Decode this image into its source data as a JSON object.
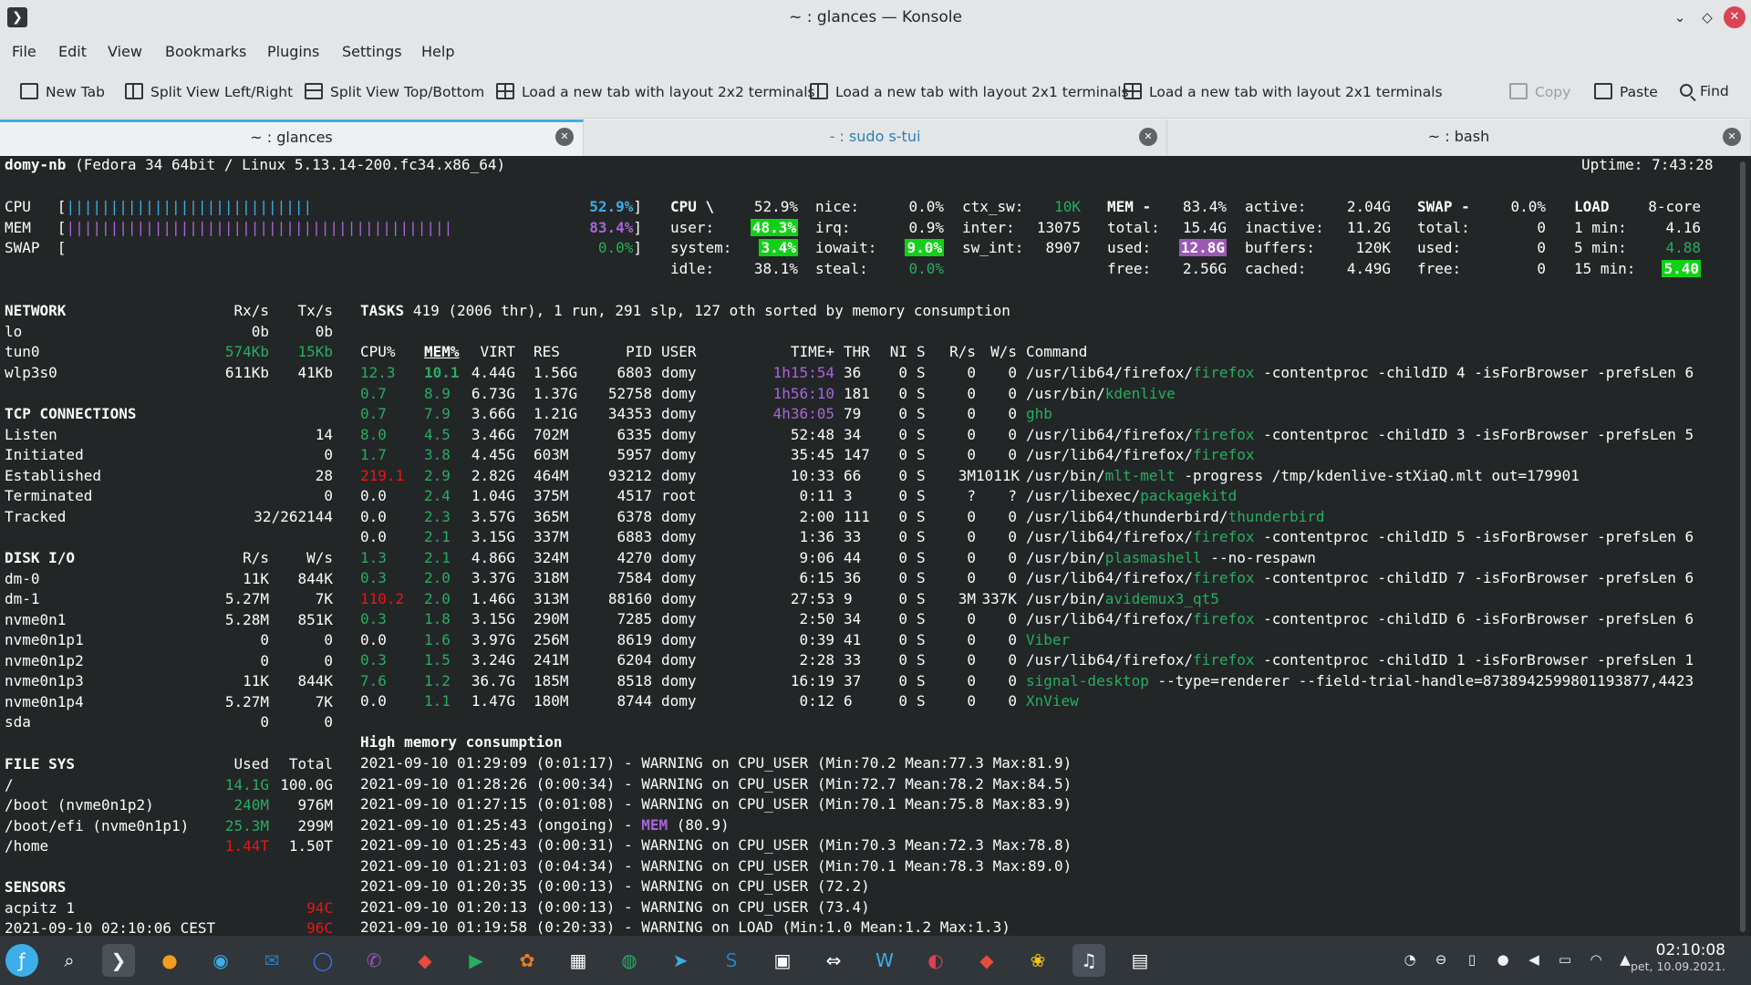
{
  "window": {
    "title": "~ : glances — Konsole",
    "minimize": "⌄",
    "maximize": "◇",
    "close": "✕"
  },
  "menu": [
    "File",
    "Edit",
    "View",
    "Bookmarks",
    "Plugins",
    "Settings",
    "Help"
  ],
  "toolbar": {
    "new_tab": "New Tab",
    "split_lr": "Split View Left/Right",
    "split_tb": "Split View Top/Bottom",
    "load_2x2": "Load a new tab with layout 2x2 terminals",
    "load_2x1_a": "Load a new tab with layout 2x1 terminals",
    "load_2x1_b": "Load a new tab with layout 2x1 terminals",
    "copy": "Copy",
    "paste": "Paste",
    "find": "Find"
  },
  "tabs": [
    {
      "label": "~ : glances"
    },
    {
      "label": "- : sudo s-tui"
    },
    {
      "label": "~ : bash"
    }
  ],
  "glances": {
    "host": "domy-nb",
    "os": "(Fedora 34 64bit / Linux 5.13.14-200.fc34.x86_64)",
    "uptime": "Uptime: 7:43:28",
    "quicklook": {
      "cpu_label": "CPU",
      "cpu_bar": "||||||||||||||||||||||||||||",
      "cpu_pct": "52.9%",
      "mem_label": "MEM",
      "mem_bar": "||||||||||||||||||||||||||||||||||||||||||||",
      "mem_pct": "83.4%",
      "swap_label": "SWAP",
      "swap_pct": "0.0%"
    },
    "cpu": {
      "title": "CPU \\",
      "total": "52.9%",
      "user_label": "user:",
      "user": "48.3%",
      "system_label": "system:",
      "system": "3.4%",
      "idle_label": "idle:",
      "idle": "38.1%",
      "nice_label": "nice:",
      "nice": "0.0%",
      "irq_label": "irq:",
      "irq": "0.9%",
      "iowait_label": "iowait:",
      "iowait": "9.0%",
      "steal_label": "steal:",
      "steal": "0.0%",
      "ctx_sw_label": "ctx_sw:",
      "ctx_sw": "10K",
      "inter_label": "inter:",
      "inter": "13075",
      "sw_int_label": "sw_int:",
      "sw_int": "8907"
    },
    "mem": {
      "title": "MEM -",
      "pct": "83.4%",
      "total_label": "total:",
      "total": "15.4G",
      "used_label": "used:",
      "used": "12.8G",
      "free_label": "free:",
      "free": "2.56G",
      "active_label": "active:",
      "active": "2.04G",
      "inactive_label": "inactive:",
      "inactive": "11.2G",
      "buffers_label": "buffers:",
      "buffers": "120K",
      "cached_label": "cached:",
      "cached": "4.49G"
    },
    "swap": {
      "title": "SWAP -",
      "pct": "0.0%",
      "total_label": "total:",
      "total": "0",
      "used_label": "used:",
      "used": "0",
      "free_label": "free:",
      "free": "0"
    },
    "load": {
      "title": "LOAD",
      "cores": "8-core",
      "min1_label": "1 min:",
      "min1": "4.16",
      "min5_label": "5 min:",
      "min5": "4.88",
      "min15_label": "15 min:",
      "min15": "5.40"
    },
    "network": {
      "title": "NETWORK",
      "rx_header": "Rx/s",
      "tx_header": "Tx/s",
      "rows": [
        {
          "iface": "lo",
          "rx": "0b",
          "tx": "0b"
        },
        {
          "iface": "tun0",
          "rx": "574Kb",
          "tx": "15Kb"
        },
        {
          "iface": "wlp3s0",
          "rx": "611Kb",
          "tx": "41Kb"
        }
      ]
    },
    "tcp": {
      "title": "TCP CONNECTIONS",
      "rows": [
        {
          "label": "Listen",
          "value": "14"
        },
        {
          "label": "Initiated",
          "value": "0"
        },
        {
          "label": "Established",
          "value": "28"
        },
        {
          "label": "Terminated",
          "value": "0"
        },
        {
          "label": "Tracked",
          "value": "32/262144"
        }
      ]
    },
    "diskio": {
      "title": "DISK I/O",
      "r_header": "R/s",
      "w_header": "W/s",
      "rows": [
        {
          "dev": "dm-0",
          "r": "11K",
          "w": "844K"
        },
        {
          "dev": "dm-1",
          "r": "5.27M",
          "w": "7K"
        },
        {
          "dev": "nvme0n1",
          "r": "5.28M",
          "w": "851K"
        },
        {
          "dev": "nvme0n1p1",
          "r": "0",
          "w": "0"
        },
        {
          "dev": "nvme0n1p2",
          "r": "0",
          "w": "0"
        },
        {
          "dev": "nvme0n1p3",
          "r": "11K",
          "w": "844K"
        },
        {
          "dev": "nvme0n1p4",
          "r": "5.27M",
          "w": "7K"
        },
        {
          "dev": "sda",
          "r": "0",
          "w": "0"
        }
      ]
    },
    "filesys": {
      "title": "FILE SYS",
      "used_header": "Used",
      "total_header": "Total",
      "rows": [
        {
          "mnt": "/",
          "used": "14.1G",
          "total": "100.0G"
        },
        {
          "mnt": "/boot (nvme0n1p2)",
          "used": "240M",
          "total": "976M"
        },
        {
          "mnt": "/boot/efi (nvme0n1p1)",
          "used": "25.3M",
          "total": "299M"
        },
        {
          "mnt": "/home",
          "used": "1.44T",
          "total": "1.50T"
        }
      ]
    },
    "sensors": {
      "title": "SENSORS",
      "rows": [
        {
          "label": "acpitz 1",
          "value": "94C"
        },
        {
          "label": "2021-09-10 02:10:06 CEST",
          "value": "96C"
        }
      ]
    },
    "tasks": {
      "summary_title": "TASKS",
      "summary": "419 (2006 thr), 1 run, 291 slp, 127 oth sorted by memory consumption",
      "headers": {
        "cpu": "CPU%",
        "mem": "MEM%",
        "virt": "VIRT",
        "res": "RES",
        "pid": "PID",
        "user": "USER",
        "time": "TIME+",
        "thr": "THR",
        "ni": "NI",
        "s": "S",
        "rs": "R/s",
        "ws": "W/s",
        "cmd": "Command"
      },
      "rows": [
        {
          "cpu": "12.3",
          "mem": "10.1",
          "virt": "4.44G",
          "res": "1.56G",
          "pid": "6803",
          "user": "domy",
          "time": "1h15:54",
          "thr": "36",
          "ni": "0",
          "s": "S",
          "rs": "0",
          "ws": "0",
          "cmd_pre": "/usr/lib64/firefox/",
          "cmd_hl": "firefox",
          "cmd_post": " -contentproc -childID 4 -isForBrowser -prefsLen 6"
        },
        {
          "cpu": "0.7",
          "mem": "8.9",
          "virt": "6.73G",
          "res": "1.37G",
          "pid": "52758",
          "user": "domy",
          "time": "1h56:10",
          "thr": "181",
          "ni": "0",
          "s": "S",
          "rs": "0",
          "ws": "0",
          "cmd_pre": "/usr/bin/",
          "cmd_hl": "kdenlive",
          "cmd_post": ""
        },
        {
          "cpu": "0.7",
          "mem": "7.9",
          "virt": "3.66G",
          "res": "1.21G",
          "pid": "34353",
          "user": "domy",
          "time": "4h36:05",
          "thr": "79",
          "ni": "0",
          "s": "S",
          "rs": "0",
          "ws": "0",
          "cmd_pre": "",
          "cmd_hl": "ghb",
          "cmd_post": ""
        },
        {
          "cpu": "8.0",
          "mem": "4.5",
          "virt": "3.46G",
          "res": "702M",
          "pid": "6335",
          "user": "domy",
          "time": "52:48",
          "thr": "34",
          "ni": "0",
          "s": "S",
          "rs": "0",
          "ws": "0",
          "cmd_pre": "/usr/lib64/firefox/",
          "cmd_hl": "firefox",
          "cmd_post": " -contentproc -childID 3 -isForBrowser -prefsLen 5"
        },
        {
          "cpu": "1.7",
          "mem": "3.8",
          "virt": "4.45G",
          "res": "603M",
          "pid": "5957",
          "user": "domy",
          "time": "35:45",
          "thr": "147",
          "ni": "0",
          "s": "S",
          "rs": "0",
          "ws": "0",
          "cmd_pre": "/usr/lib64/firefox/",
          "cmd_hl": "firefox",
          "cmd_post": ""
        },
        {
          "cpu": "219.1",
          "mem": "2.9",
          "virt": "2.82G",
          "res": "464M",
          "pid": "93212",
          "user": "domy",
          "time": "10:33",
          "thr": "66",
          "ni": "0",
          "s": "S",
          "rs": "3M",
          "ws": "1011K",
          "cmd_pre": "/usr/bin/",
          "cmd_hl": "mlt-melt",
          "cmd_post": " -progress /tmp/kdenlive-stXiaQ.mlt out=179901"
        },
        {
          "cpu": "0.0",
          "mem": "2.4",
          "virt": "1.04G",
          "res": "375M",
          "pid": "4517",
          "user": "root",
          "time": "0:11",
          "thr": "3",
          "ni": "0",
          "s": "S",
          "rs": "?",
          "ws": "?",
          "cmd_pre": "/usr/libexec/",
          "cmd_hl": "packagekitd",
          "cmd_post": ""
        },
        {
          "cpu": "0.0",
          "mem": "2.3",
          "virt": "3.57G",
          "res": "365M",
          "pid": "6378",
          "user": "domy",
          "time": "2:00",
          "thr": "111",
          "ni": "0",
          "s": "S",
          "rs": "0",
          "ws": "0",
          "cmd_pre": "/usr/lib64/thunderbird/",
          "cmd_hl": "thunderbird",
          "cmd_post": ""
        },
        {
          "cpu": "0.0",
          "mem": "2.1",
          "virt": "3.15G",
          "res": "337M",
          "pid": "6883",
          "user": "domy",
          "time": "1:36",
          "thr": "33",
          "ni": "0",
          "s": "S",
          "rs": "0",
          "ws": "0",
          "cmd_pre": "/usr/lib64/firefox/",
          "cmd_hl": "firefox",
          "cmd_post": " -contentproc -childID 5 -isForBrowser -prefsLen 6"
        },
        {
          "cpu": "1.3",
          "mem": "2.1",
          "virt": "4.86G",
          "res": "324M",
          "pid": "4270",
          "user": "domy",
          "time": "9:06",
          "thr": "44",
          "ni": "0",
          "s": "S",
          "rs": "0",
          "ws": "0",
          "cmd_pre": "/usr/bin/",
          "cmd_hl": "plasmashell",
          "cmd_post": " --no-respawn"
        },
        {
          "cpu": "0.3",
          "mem": "2.0",
          "virt": "3.37G",
          "res": "318M",
          "pid": "7584",
          "user": "domy",
          "time": "6:15",
          "thr": "36",
          "ni": "0",
          "s": "S",
          "rs": "0",
          "ws": "0",
          "cmd_pre": "/usr/lib64/firefox/",
          "cmd_hl": "firefox",
          "cmd_post": " -contentproc -childID 7 -isForBrowser -prefsLen 6"
        },
        {
          "cpu": "110.2",
          "mem": "2.0",
          "virt": "1.46G",
          "res": "313M",
          "pid": "88160",
          "user": "domy",
          "time": "27:53",
          "thr": "9",
          "ni": "0",
          "s": "S",
          "rs": "3M",
          "ws": "337K",
          "cmd_pre": "/usr/bin/",
          "cmd_hl": "avidemux3_qt5",
          "cmd_post": ""
        },
        {
          "cpu": "0.3",
          "mem": "1.8",
          "virt": "3.15G",
          "res": "290M",
          "pid": "7285",
          "user": "domy",
          "time": "2:50",
          "thr": "34",
          "ni": "0",
          "s": "S",
          "rs": "0",
          "ws": "0",
          "cmd_pre": "/usr/lib64/firefox/",
          "cmd_hl": "firefox",
          "cmd_post": " -contentproc -childID 6 -isForBrowser -prefsLen 6"
        },
        {
          "cpu": "0.0",
          "mem": "1.6",
          "virt": "3.97G",
          "res": "256M",
          "pid": "8619",
          "user": "domy",
          "time": "0:39",
          "thr": "41",
          "ni": "0",
          "s": "S",
          "rs": "0",
          "ws": "0",
          "cmd_pre": "",
          "cmd_hl": "Viber",
          "cmd_post": ""
        },
        {
          "cpu": "0.3",
          "mem": "1.5",
          "virt": "3.24G",
          "res": "241M",
          "pid": "6204",
          "user": "domy",
          "time": "2:28",
          "thr": "33",
          "ni": "0",
          "s": "S",
          "rs": "0",
          "ws": "0",
          "cmd_pre": "/usr/lib64/firefox/",
          "cmd_hl": "firefox",
          "cmd_post": " -contentproc -childID 1 -isForBrowser -prefsLen 1"
        },
        {
          "cpu": "7.6",
          "mem": "1.2",
          "virt": "36.7G",
          "res": "185M",
          "pid": "8518",
          "user": "domy",
          "time": "16:19",
          "thr": "37",
          "ni": "0",
          "s": "S",
          "rs": "0",
          "ws": "0",
          "cmd_pre": "",
          "cmd_hl": "signal-desktop",
          "cmd_post": " --type=renderer --field-trial-handle=8738942599801193877,4423"
        },
        {
          "cpu": "0.0",
          "mem": "1.1",
          "virt": "1.47G",
          "res": "180M",
          "pid": "8744",
          "user": "domy",
          "time": "0:12",
          "thr": "6",
          "ni": "0",
          "s": "S",
          "rs": "0",
          "ws": "0",
          "cmd_pre": "",
          "cmd_hl": "XnView",
          "cmd_post": ""
        }
      ]
    },
    "alerts": {
      "title": "High memory consumption",
      "rows": [
        {
          "pre": "2021-09-10 01:29:09 (0:01:17) - WARNING on CPU_USER (Min:70.2 Mean:77.3 Max:81.9)",
          "hl": "",
          "post": ""
        },
        {
          "pre": "2021-09-10 01:28:26 (0:00:34) - WARNING on CPU_USER (Min:72.7 Mean:78.2 Max:84.5)",
          "hl": "",
          "post": ""
        },
        {
          "pre": "2021-09-10 01:27:15 (0:01:08) - WARNING on CPU_USER (Min:70.1 Mean:75.8 Max:83.9)",
          "hl": "",
          "post": ""
        },
        {
          "pre": "2021-09-10 01:25:43 (ongoing) - ",
          "hl": "MEM",
          "post": " (80.9)"
        },
        {
          "pre": "2021-09-10 01:25:43 (0:00:31) - WARNING on CPU_USER (Min:70.3 Mean:72.3 Max:78.8)",
          "hl": "",
          "post": ""
        },
        {
          "pre": "2021-09-10 01:21:03 (0:04:34) - WARNING on CPU_USER (Min:70.1 Mean:78.3 Max:89.0)",
          "hl": "",
          "post": ""
        },
        {
          "pre": "2021-09-10 01:20:35 (0:00:13) - WARNING on CPU_USER (72.2)",
          "hl": "",
          "post": ""
        },
        {
          "pre": "2021-09-10 01:20:13 (0:00:13) - WARNING on CPU_USER (73.4)",
          "hl": "",
          "post": ""
        },
        {
          "pre": "2021-09-10 01:19:58 (0:20:33) - WARNING on LOAD (Min:1.0 Mean:1.2 Max:1.3)",
          "hl": "",
          "post": ""
        }
      ]
    }
  },
  "taskbar": {
    "clock_time": "02:10:08",
    "clock_date": "pet, 10.09.2021.",
    "apps": [
      "fedora-launcher-icon",
      "search-icon",
      "konsole-icon",
      "firefox-icon",
      "chromium-icon",
      "thunderbird-icon",
      "signal-icon",
      "viber-icon",
      "anydesk-icon",
      "play-icon",
      "gimp-icon",
      "calculator-icon",
      "gpu-icon",
      "telegram-icon",
      "shazam-icon",
      "network-monitor-icon",
      "teamviewer-icon",
      "writer-icon",
      "davinci-icon",
      "kdenlive-icon",
      "pineapple-icon",
      "audio-icon",
      "clapper-icon"
    ]
  }
}
